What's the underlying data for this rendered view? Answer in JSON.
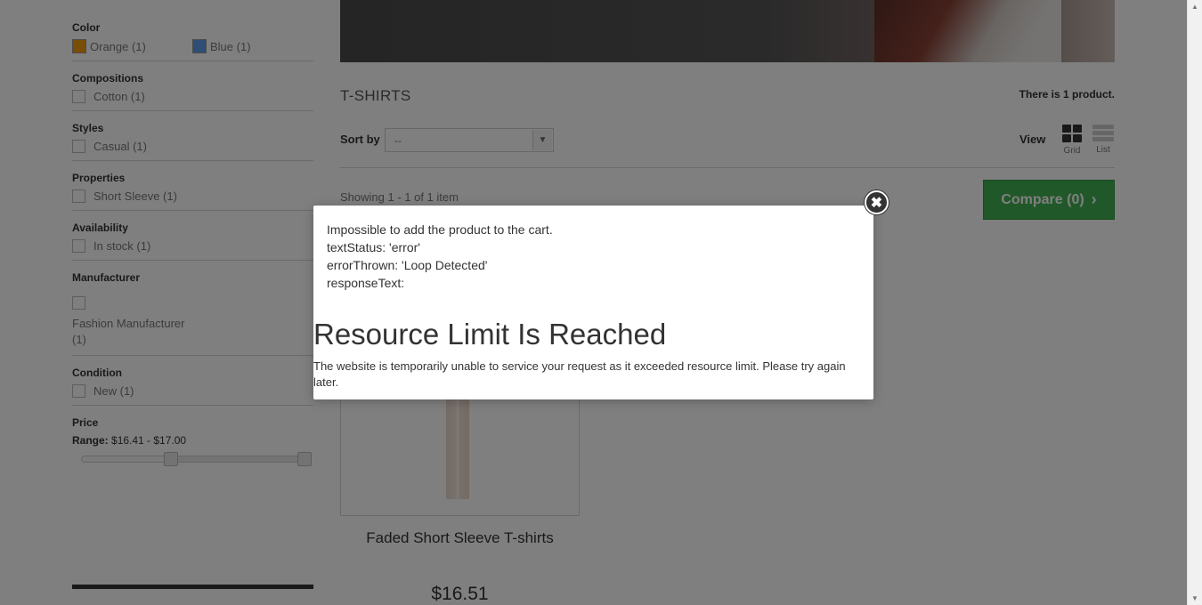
{
  "filters": {
    "color": {
      "title": "Color",
      "items": [
        {
          "label": "Orange (1)",
          "swatch": "#f39c11"
        },
        {
          "label": "Blue (1)",
          "swatch": "#5d9cec"
        }
      ]
    },
    "compositions": {
      "title": "Compositions",
      "items": [
        "Cotton (1)"
      ]
    },
    "styles": {
      "title": "Styles",
      "items": [
        "Casual (1)"
      ]
    },
    "properties": {
      "title": "Properties",
      "items": [
        "Short Sleeve (1)"
      ]
    },
    "availability": {
      "title": "Availability",
      "items": [
        "In stock (1)"
      ]
    },
    "manufacturer": {
      "title": "Manufacturer",
      "items": [
        "Fashion Manufacturer (1)"
      ]
    },
    "condition": {
      "title": "Condition",
      "items": [
        "New (1)"
      ]
    },
    "price": {
      "title": "Price",
      "range_label": "Range:",
      "range_value": "$16.41 - $17.00"
    }
  },
  "category": {
    "title": "T-SHIRTS",
    "product_count": "There is 1 product.",
    "sort_label": "Sort by",
    "sort_value": "--",
    "view_label": "View",
    "view_grid": "Grid",
    "view_list": "List",
    "showing": "Showing 1 - 1 of 1 item",
    "compare_label": "Compare (0)"
  },
  "product": {
    "name": "Faded Short Sleeve T-shirts",
    "price": "$16.51"
  },
  "modal": {
    "message_lines": [
      "Impossible to add the product to the cart.",
      "textStatus: 'error'",
      "errorThrown: 'Loop Detected'",
      "responseText:"
    ],
    "heading": "Resource Limit Is Reached",
    "body": "The website is temporarily unable to service your request as it exceeded resource limit. Please try again later."
  },
  "colors": {
    "compare_green": "#43b155",
    "overlay": "rgba(0,0,0,0.5)"
  }
}
